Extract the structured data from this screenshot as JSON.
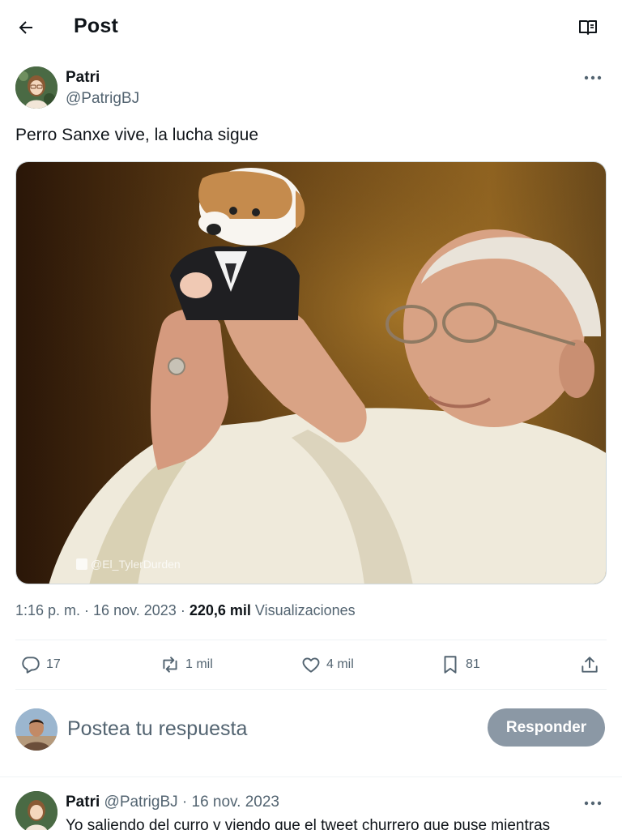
{
  "header": {
    "title": "Post"
  },
  "post": {
    "author_name": "Patri",
    "author_handle": "@PatrigBJ",
    "text": "Perro Sanxe vive, la lucha sigue",
    "image_watermark": "@El_TylerDurden",
    "time": "1:16 p. m.",
    "date": "16 nov. 2023",
    "views_count": "220,6 mil",
    "views_label": "Visualizaciones",
    "sep": " · "
  },
  "actions": {
    "replies": "17",
    "reposts": "1 mil",
    "likes": "4 mil",
    "bookmarks": "81"
  },
  "composer": {
    "placeholder": "Postea tu respuesta",
    "button_label": "Responder"
  },
  "reply": {
    "author_name": "Patri",
    "meta": "@PatrigBJ · 16 nov. 2023",
    "text": "Yo saliendo del curro y viendo que el tweet churrero que puse mientras"
  },
  "colors": {
    "text_primary": "#0f1419",
    "text_secondary": "#536471",
    "button_disabled": "#8b98a5",
    "divider": "#eff3f4"
  }
}
